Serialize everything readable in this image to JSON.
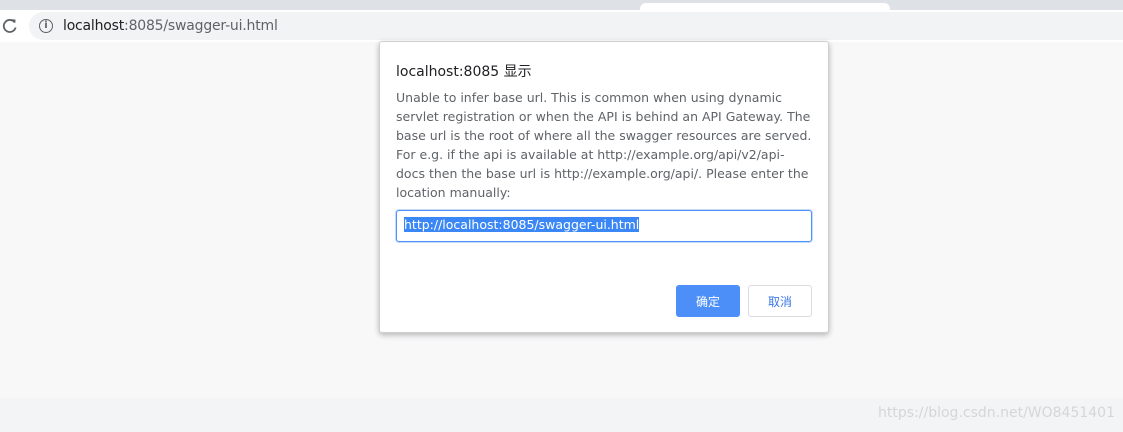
{
  "browser": {
    "url_host": "localhost",
    "url_rest": ":8085/swagger-ui.html",
    "icons": {
      "reload": "reload-icon",
      "site_info": "info-icon"
    }
  },
  "dialog": {
    "title": "localhost:8085 显示",
    "message": "Unable to infer base url. This is common when using dynamic\nservlet registration or when the API is behind an API Gateway. The\nbase url is the root of where all the swagger resources are served.\nFor e.g. if the api is available at http://example.org/api/v2/api-\ndocs then the base url is http://example.org/api/. Please enter the\nlocation manually:",
    "input_value": "http://localhost:8085/swagger-ui.html",
    "ok_label": "确定",
    "cancel_label": "取消"
  },
  "watermark": "https://blog.csdn.net/WO8451401",
  "colors": {
    "accent": "#4d8ff8",
    "selection": "#3b87f5"
  }
}
